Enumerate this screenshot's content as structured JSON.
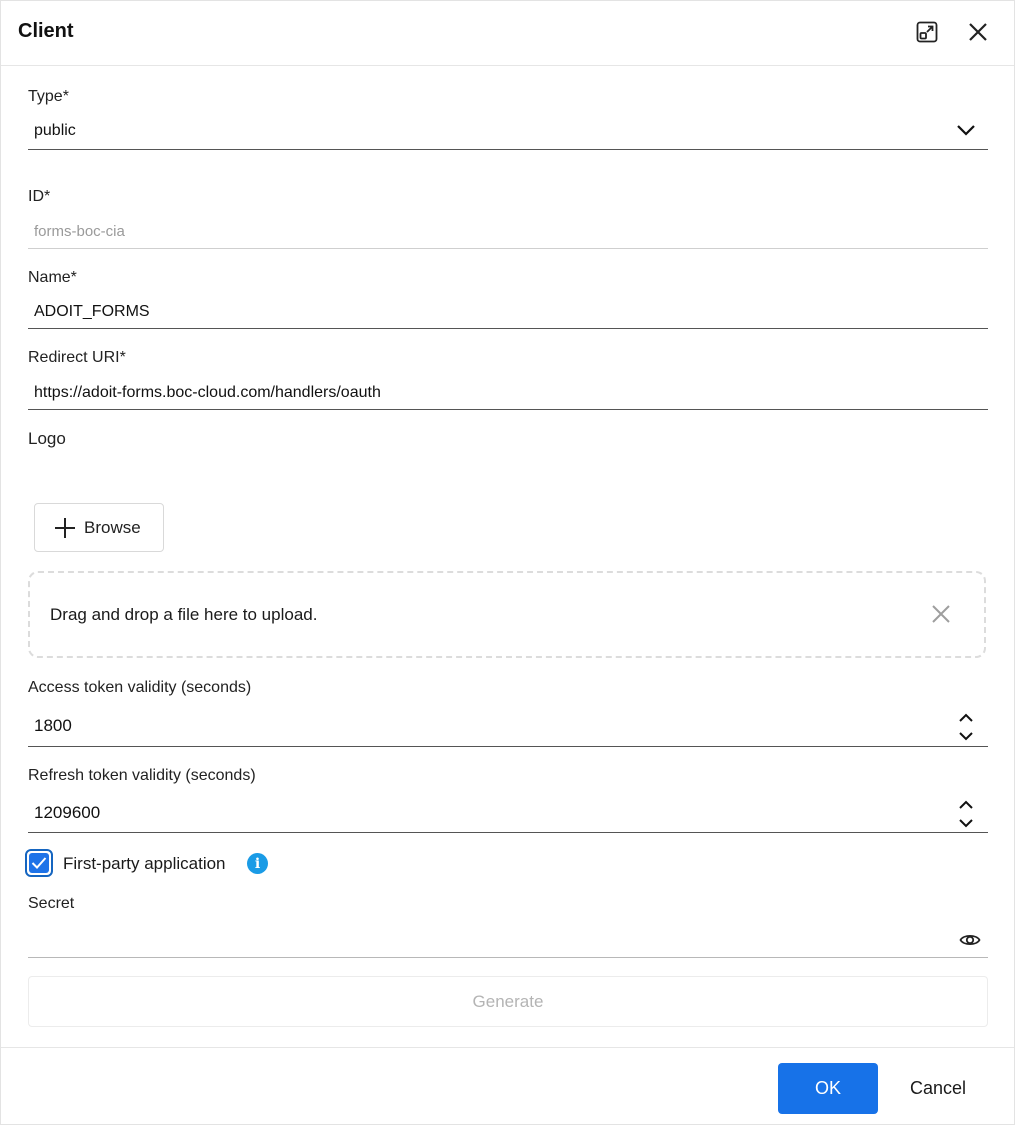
{
  "dialog": {
    "title": "Client",
    "icons": {
      "expand": "expand-window-icon",
      "close": "close-icon"
    }
  },
  "form": {
    "type": {
      "label": "Type*",
      "value": "public"
    },
    "id": {
      "label": "ID*",
      "value": "forms-boc-cia"
    },
    "name": {
      "label": "Name*",
      "value": "ADOIT_FORMS"
    },
    "redirect_uri": {
      "label": "Redirect URI*",
      "value": "https://adoit-forms.boc-cloud.com/handlers/oauth"
    },
    "logo": {
      "label": "Logo",
      "browse_label": "Browse",
      "dropzone_text": "Drag and drop a file here to upload."
    },
    "access_token": {
      "label": "Access token validity (seconds)",
      "value": "1800"
    },
    "refresh_token": {
      "label": "Refresh token validity (seconds)",
      "value": "1209600"
    },
    "first_party": {
      "label": "First-party application",
      "checked": true
    },
    "secret": {
      "label": "Secret",
      "value": ""
    },
    "generate_label": "Generate"
  },
  "footer": {
    "ok_label": "OK",
    "cancel_label": "Cancel"
  },
  "colors": {
    "primary": "#1772e8",
    "info": "#1a9be6",
    "checkbox_border": "#1565c0"
  }
}
